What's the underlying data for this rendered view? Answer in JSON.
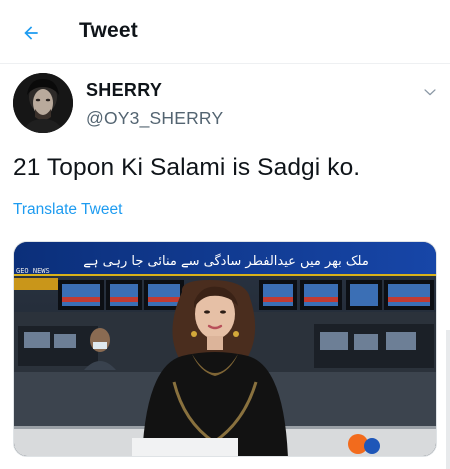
{
  "header": {
    "title": "Tweet",
    "back_icon": "arrow-left-icon",
    "accent": "#1d9bf0"
  },
  "author": {
    "display_name": "SHERRY",
    "handle": "@OY3_SHERRY",
    "more_icon": "chevron-down-icon"
  },
  "tweet": {
    "text": "21 Topon Ki Salami is Sadgi ko.",
    "translate_label": "Translate Tweet"
  },
  "media": {
    "ticker_text": "ملک بھر میں عیدالفطر سادگی سے منائی جا رہی ہے",
    "channel_label": "GEO NEWS"
  },
  "colors": {
    "text_primary": "#0f1419",
    "text_secondary": "#536471",
    "link": "#1d9bf0"
  }
}
